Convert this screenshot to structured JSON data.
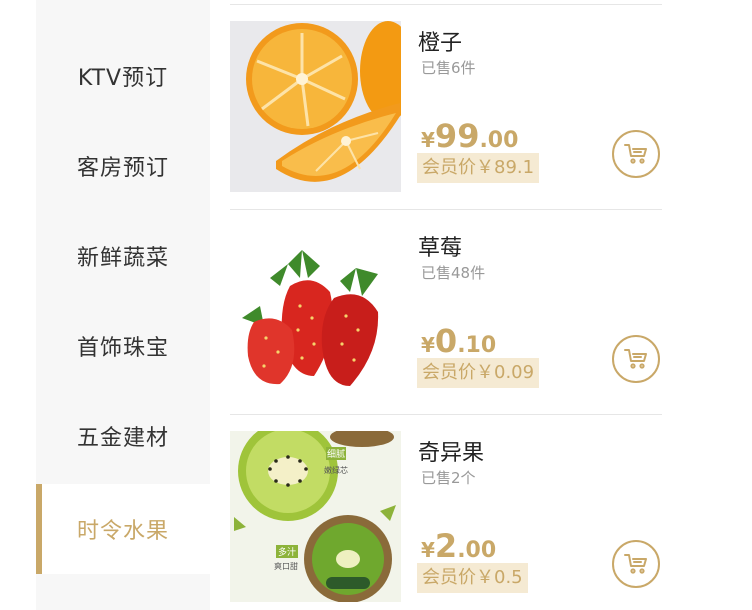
{
  "sidebar": {
    "items": [
      {
        "label": "KTV预订"
      },
      {
        "label": "客房预订"
      },
      {
        "label": "新鲜蔬菜"
      },
      {
        "label": "首饰珠宝"
      },
      {
        "label": "五金建材"
      },
      {
        "label": "时令水果"
      }
    ],
    "active_index": 5
  },
  "products": [
    {
      "name": "橙子",
      "sold": "已售6件",
      "price_symbol": "¥",
      "price_int": "99",
      "price_dec": ".00",
      "member_price": "会员价￥89.1",
      "image": "orange-image"
    },
    {
      "name": "草莓",
      "sold": "已售48件",
      "price_symbol": "¥",
      "price_int": "0",
      "price_dec": ".10",
      "member_price": "会员价￥0.09",
      "image": "strawberry-image"
    },
    {
      "name": "奇异果",
      "sold": "已售2个",
      "price_symbol": "¥",
      "price_int": "2",
      "price_dec": ".00",
      "member_price": "会员价￥0.5",
      "image": "kiwi-image",
      "image_tags": [
        "细腻",
        "嫩绿芯",
        "多汁",
        "爽口甜"
      ]
    }
  ],
  "colors": {
    "accent": "#c9a868",
    "member_bg": "#f5ead3",
    "sidebar_bg": "#f7f7f7"
  },
  "icons": {
    "cart": "cart-icon"
  }
}
